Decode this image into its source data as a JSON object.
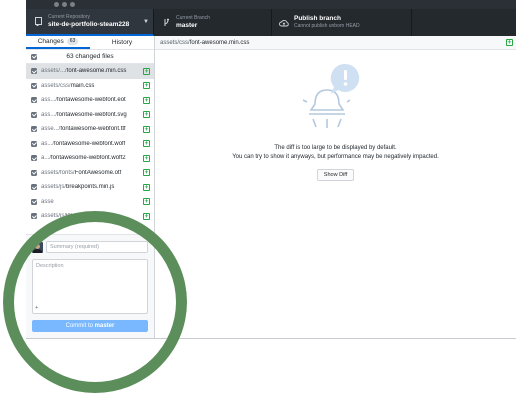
{
  "toolbar": {
    "repo_caption": "Current Repository",
    "repo_name": "site-de-portfolio-steam228",
    "branch_caption": "Current Branch",
    "branch_name": "master",
    "publish_title": "Publish branch",
    "publish_caption": "Cannot publish unborn HEAD"
  },
  "sidebar": {
    "tabs": [
      {
        "label": "Changes",
        "count": "63"
      },
      {
        "label": "History"
      }
    ],
    "changed_files_label": "63 changed files",
    "files": [
      {
        "dir": "assets/.../",
        "name": "font-awesome.min.css"
      },
      {
        "dir": "assets/css/",
        "name": "main.css"
      },
      {
        "dir": "ass.../",
        "name": "fontawesome-webfont.eot"
      },
      {
        "dir": "ass.../",
        "name": "fontawesome-webfont.svg"
      },
      {
        "dir": "asse.../",
        "name": "fontawesome-webfont.ttf"
      },
      {
        "dir": "as.../",
        "name": "fontawesome-webfont.woff"
      },
      {
        "dir": "a.../",
        "name": "fontawesome-webfont.woff2"
      },
      {
        "dir": "assets/fonts/",
        "name": "FontAwesome.otf"
      },
      {
        "dir": "assets/js/",
        "name": "breakpoints.min.js"
      },
      {
        "dir": "asse",
        "name": ""
      },
      {
        "dir": "assets/js/",
        "name": "jquery.min.js"
      }
    ]
  },
  "commit": {
    "summary_placeholder": "Summary (required)",
    "description_placeholder": "Description",
    "coauthor_icon": "+",
    "button_prefix": "Commit to ",
    "button_branch": "master"
  },
  "diff": {
    "path_dir": "assets/css/",
    "path_file": "font-awesome.min.css",
    "message_line1": "The diff is too large to be displayed by default.",
    "message_line2": "You can try to show it anyways, but performance may be negatively impacted.",
    "show_diff_label": "Show Diff"
  },
  "colors": {
    "accent_blue": "#0366d6",
    "added_green": "#28a745",
    "annotation_green": "#5b8e5a",
    "commit_button": "#79b8ff"
  }
}
